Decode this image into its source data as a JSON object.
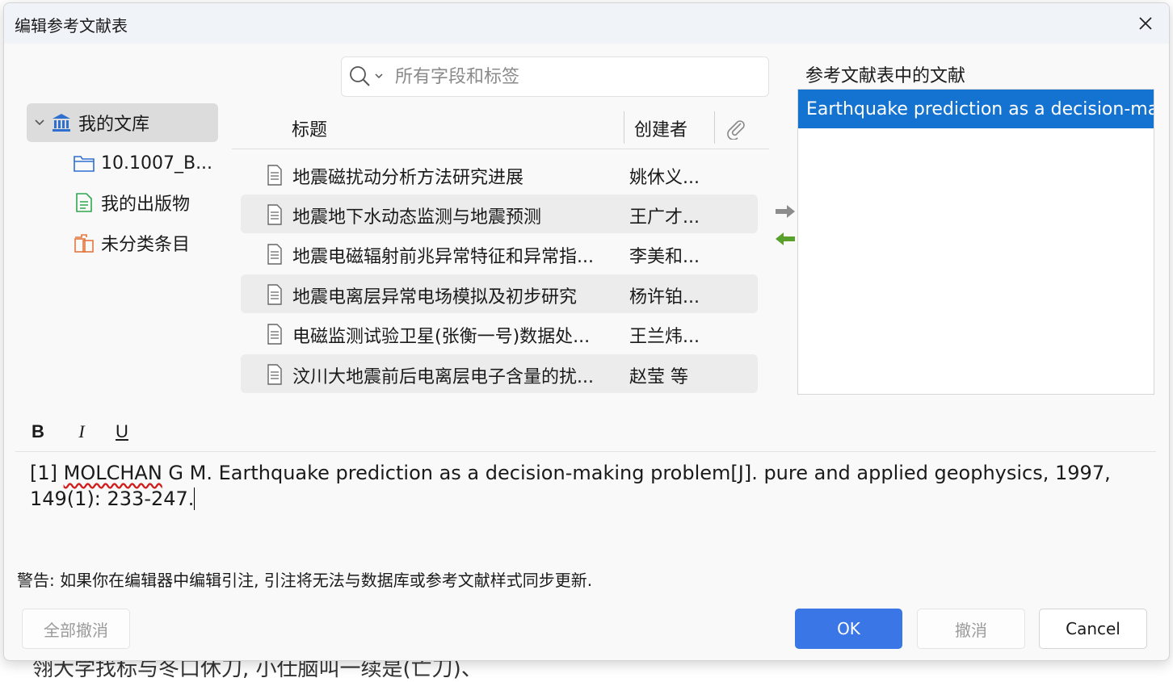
{
  "dialog": {
    "title": "编辑参考文献表"
  },
  "search": {
    "placeholder": "所有字段和标签"
  },
  "library": {
    "root_label": "我的文库",
    "items": [
      {
        "label": "10.1007_B..."
      },
      {
        "label": "我的出版物"
      },
      {
        "label": "未分类条目"
      }
    ]
  },
  "table": {
    "headers": {
      "title": "标题",
      "creator": "创建者"
    },
    "rows": [
      {
        "title": "地震磁扰动分析方法研究进展",
        "creator": "姚休义..."
      },
      {
        "title": "地震地下水动态监测与地震预测",
        "creator": "王广才..."
      },
      {
        "title": "地震电磁辐射前兆异常特征和异常指...",
        "creator": "李美和..."
      },
      {
        "title": "地震电离层异常电场模拟及初步研究",
        "creator": "杨许铂..."
      },
      {
        "title": "电磁监测试验卫星(张衡一号)数据处...",
        "creator": "王兰炜..."
      },
      {
        "title": "汶川大地震前后电离层电子含量的扰...",
        "creator": "赵莹 等"
      }
    ]
  },
  "bibliography": {
    "label": "参考文献表中的文献",
    "items": [
      {
        "label": "Earthquake prediction as a decision-ma"
      }
    ]
  },
  "format": {
    "bold": "B",
    "italic": "I",
    "underline": "U"
  },
  "editor": {
    "prefix": "[1] ",
    "misspelled": "MOLCHAN",
    "line1_rest": " G M. Earthquake prediction as a decision-making problem[J]. pure and applied geophysics, 1997,",
    "line2": "149(1): 233-247."
  },
  "warning": "警告: 如果你在编辑器中编辑引注, 引注将无法与数据库或参考文献样式同步更新.",
  "buttons": {
    "revert": "全部撤消",
    "ok": "OK",
    "undo": "撤消",
    "cancel": "Cancel"
  },
  "colors": {
    "accent": "#3a76e6",
    "selection": "#1473d1",
    "add_arrow": "#8c8c8c",
    "remove_arrow": "#5aa02c"
  },
  "background": {
    "bottom_text": "翎大学找标与冬口休刀, 小仕脑叫一续是(亡刀)、"
  }
}
